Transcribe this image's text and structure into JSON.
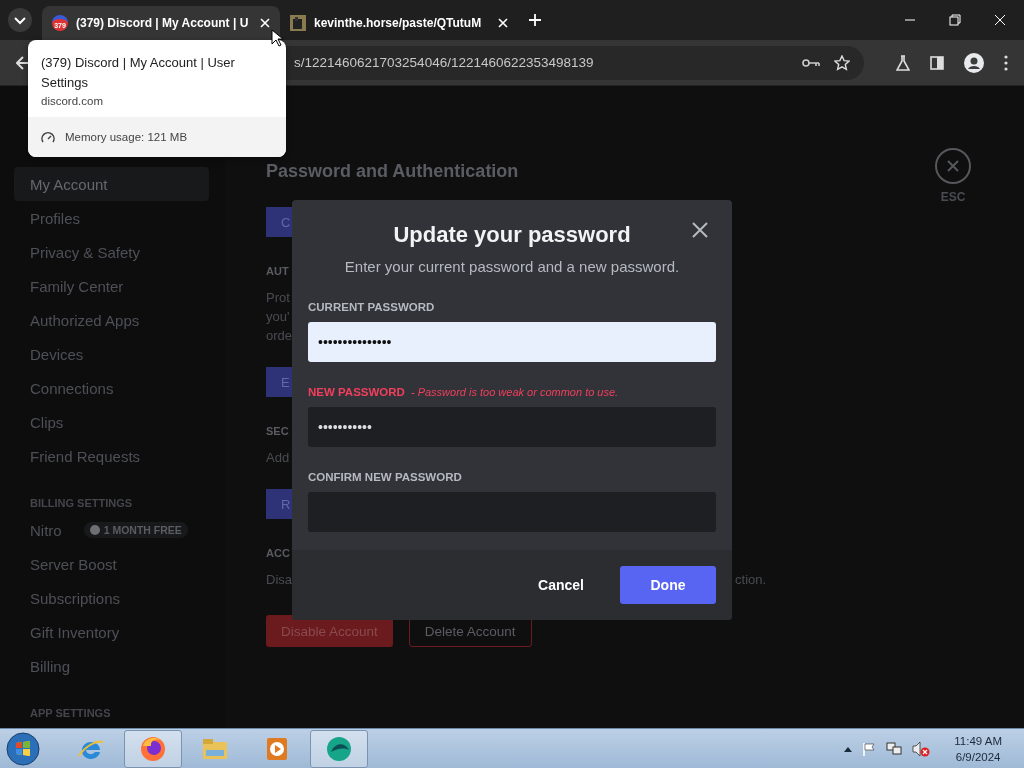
{
  "browser": {
    "tabs": [
      {
        "title": "(379) Discord | My Account | U",
        "favicon_badge": "379",
        "selected": true
      },
      {
        "title": "kevinthe.horse/paste/QTutuM",
        "selected": false
      }
    ],
    "address": {
      "url": "s/1221460621703254046/1221460622353498139"
    },
    "hover_card": {
      "title": "(379) Discord | My Account | User Settings",
      "domain": "discord.com",
      "memory": "Memory usage: 121 MB"
    }
  },
  "sidebar": {
    "sections": [
      {
        "items": [
          {
            "label": "My Account",
            "selected": true
          },
          {
            "label": "Profiles",
            "selected": false
          },
          {
            "label": "Privacy & Safety",
            "selected": false
          },
          {
            "label": "Family Center",
            "selected": false
          },
          {
            "label": "Authorized Apps",
            "selected": false
          },
          {
            "label": "Devices",
            "selected": false
          },
          {
            "label": "Connections",
            "selected": false
          },
          {
            "label": "Clips",
            "selected": false
          },
          {
            "label": "Friend Requests",
            "selected": false
          }
        ]
      },
      {
        "header": "BILLING SETTINGS",
        "items": [
          {
            "label": "Nitro",
            "badge": "1 MONTH FREE",
            "selected": false
          },
          {
            "label": "Server Boost",
            "selected": false
          },
          {
            "label": "Subscriptions",
            "selected": false
          },
          {
            "label": "Gift Inventory",
            "selected": false
          },
          {
            "label": "Billing",
            "selected": false
          }
        ]
      },
      {
        "header": "APP SETTINGS"
      }
    ]
  },
  "content": {
    "heading": "Password and Authentication",
    "blocks": [
      {
        "kind": "button",
        "label": "C"
      },
      {
        "kind": "label",
        "text": "AUT"
      },
      {
        "kind": "lines",
        "lines": [
          "Prot",
          "you'",
          "orde"
        ]
      },
      {
        "kind": "button",
        "label": "E"
      },
      {
        "kind": "label",
        "text": "SEC"
      },
      {
        "kind": "lines",
        "lines": [
          "Add"
        ]
      },
      {
        "kind": "button",
        "label": "R"
      },
      {
        "kind": "label",
        "text": "ACC"
      },
      {
        "kind": "split",
        "left": "Disa",
        "right": "ction."
      },
      {
        "kind": "actions",
        "buttons": [
          {
            "label": "Disable Account",
            "kind": "danger"
          },
          {
            "label": "Delete Account",
            "kind": "outline"
          }
        ]
      }
    ]
  },
  "close": {
    "label": "ESC"
  },
  "modal": {
    "title": "Update your password",
    "subtitle": "Enter your current password and a new password.",
    "fields": [
      {
        "label": "CURRENT PASSWORD",
        "value": "•••••••••••••••",
        "focused": true
      },
      {
        "label": "NEW PASSWORD",
        "error": "- Password is too weak or common to use.",
        "value": "•••••••••••",
        "focused": false
      },
      {
        "label": "CONFIRM NEW PASSWORD",
        "focused": false
      }
    ],
    "buttons": [
      {
        "label": "Cancel",
        "kind": "link"
      },
      {
        "label": "Done",
        "kind": "primary"
      }
    ]
  },
  "taskbar": {
    "apps": [
      {
        "kind": "ie",
        "active": false
      },
      {
        "kind": "firefox",
        "active": true
      },
      {
        "kind": "explorer",
        "active": false
      },
      {
        "kind": "media",
        "active": false
      },
      {
        "kind": "app",
        "active": true
      }
    ],
    "clock": {
      "time": "11:49 AM",
      "date": "6/9/2024"
    }
  }
}
